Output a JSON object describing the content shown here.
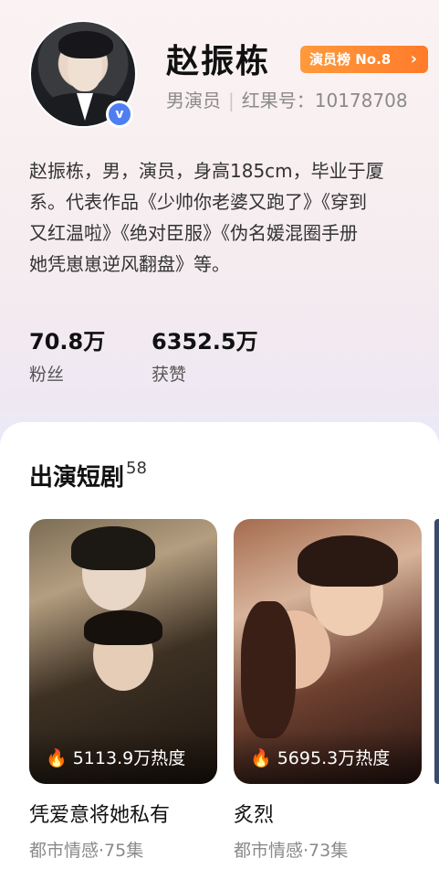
{
  "profile": {
    "name": "赵振栋",
    "rank_badge": "演员榜 No.8",
    "role": "男演员",
    "id_text": "红果号：10178708",
    "bio_lines": [
      "赵振栋，男，演员，身高185cm，毕业于厦",
      "系。代表作品《少帅你老婆又跑了》《穿到",
      "又红温啦》《绝对臣服》《伪名媛混圈手册",
      "她凭崽崽逆风翻盘》等。"
    ],
    "stats": [
      {
        "value": "70.8万",
        "label": "粉丝"
      },
      {
        "value": "6352.5万",
        "label": "获赞"
      }
    ]
  },
  "section": {
    "title": "出演短剧",
    "count": "58"
  },
  "dramas": [
    {
      "title": "凭爱意将她私有",
      "heat": "5113.9万热度",
      "sub": "都市情感·75集"
    },
    {
      "title": "炙烈",
      "heat": "5695.3万热度",
      "sub": "都市情感·73集"
    }
  ],
  "icons": {
    "verified": "v-badge-icon",
    "flame": "flame-icon",
    "chevron": "chevron-right-icon"
  },
  "colors": {
    "badge": "#ff8a33",
    "verified": "#4e7ef2"
  }
}
